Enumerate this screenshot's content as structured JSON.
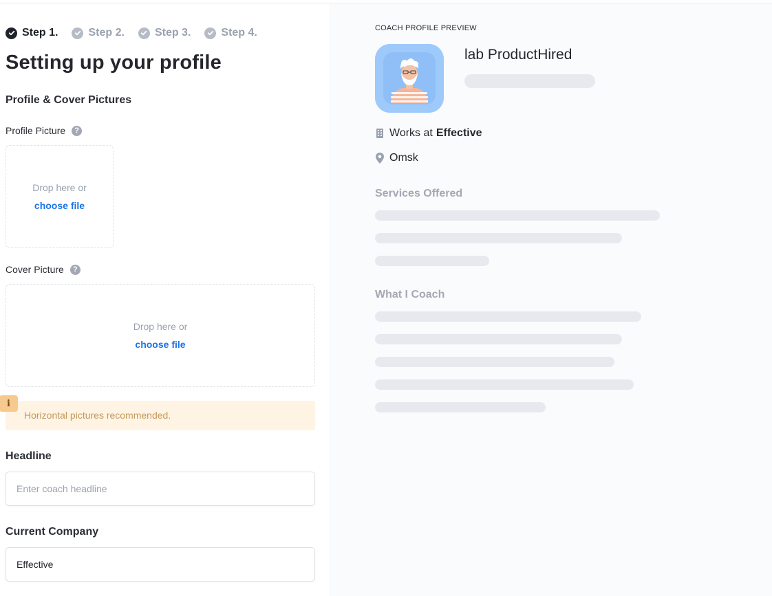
{
  "steps": [
    {
      "label": "Step 1.",
      "active": true
    },
    {
      "label": "Step 2.",
      "active": false
    },
    {
      "label": "Step 3.",
      "active": false
    },
    {
      "label": "Step 4.",
      "active": false
    }
  ],
  "page_title": "Setting up your profile",
  "pictures_section": {
    "title": "Profile & Cover Pictures",
    "profile_label": "Profile Picture",
    "cover_label": "Cover Picture",
    "drop_text": "Drop here or",
    "choose_text": "choose file",
    "help_glyph": "?"
  },
  "notice": {
    "icon": "i",
    "text": "Horizontal pictures recommended."
  },
  "headline": {
    "label": "Headline",
    "placeholder": "Enter coach headline"
  },
  "company": {
    "label": "Current Company",
    "value": "Effective"
  },
  "preview": {
    "label": "COACH PROFILE PREVIEW",
    "name": "lab ProductHired",
    "works_at_prefix": "Works at",
    "company": "Effective",
    "location": "Omsk",
    "services_title": "Services Offered",
    "coach_title": "What I Coach"
  },
  "colors": {
    "accent_link": "#1b73e8",
    "avatar_bg": "#9ec9fb",
    "notice_bg": "#fff3e4",
    "skeleton": "#e8e9ee"
  },
  "icons": {
    "step": "check-circle-icon",
    "help": "question-circle-icon",
    "notice": "info-icon",
    "work": "building-icon",
    "location": "map-pin-icon"
  }
}
